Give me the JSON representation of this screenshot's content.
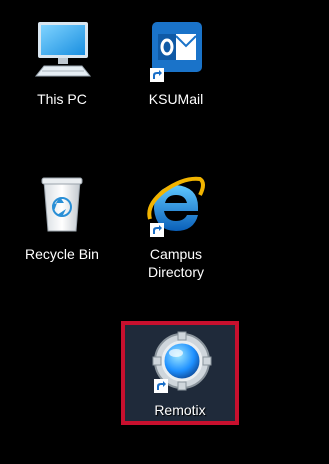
{
  "desktop": {
    "background_color": "#000000",
    "highlight_color": "#c8102e",
    "icons": [
      {
        "label": "This PC",
        "icon": "computer-icon"
      },
      {
        "label": "KSUMail",
        "icon": "outlook-icon",
        "shortcut": true
      },
      {
        "label": "Recycle Bin",
        "icon": "recycle-bin-icon"
      },
      {
        "label": "Campus Directory",
        "label_lines": [
          "Campus",
          "Directory"
        ],
        "icon": "internet-explorer-icon",
        "shortcut": true
      },
      {
        "label": "Remotix",
        "icon": "remotix-icon",
        "shortcut": true,
        "selected": true
      }
    ]
  }
}
